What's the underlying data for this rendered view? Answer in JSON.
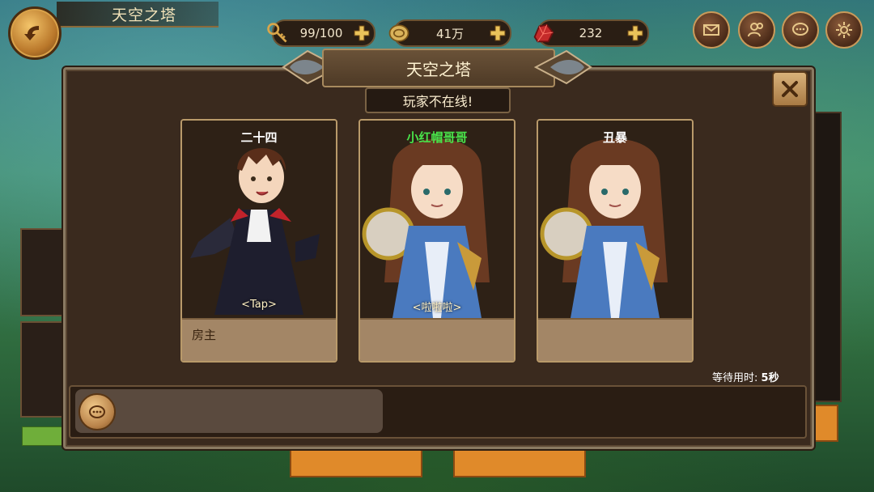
{
  "screen": {
    "title": "天空之塔"
  },
  "resources": [
    {
      "icon": "key-icon",
      "value": "99/100"
    },
    {
      "icon": "coin-icon",
      "value": "41万"
    },
    {
      "icon": "gem-icon",
      "value": "232"
    }
  ],
  "top_icons": [
    "mail-icon",
    "friends-icon",
    "chat-icon",
    "settings-icon"
  ],
  "dialog": {
    "title": "天空之塔",
    "status": "玩家不在线!",
    "players": [
      {
        "name": "二十四",
        "name_color": "#ffffff",
        "tag": "<Tap>",
        "role": "房主"
      },
      {
        "name": "小红帽哥哥",
        "name_color": "#49e34a",
        "tag": "<啦啦啦>",
        "role": ""
      },
      {
        "name": "丑暴",
        "name_color": "#ffffff",
        "tag": "",
        "role": ""
      }
    ],
    "wait_label": "等待用时:",
    "wait_value": "5秒"
  },
  "colors": {
    "accent_gold": "#c99a5a",
    "panel": "#3a2a1e",
    "card_footer": "#a38666",
    "highlight_green": "#49e34a"
  }
}
